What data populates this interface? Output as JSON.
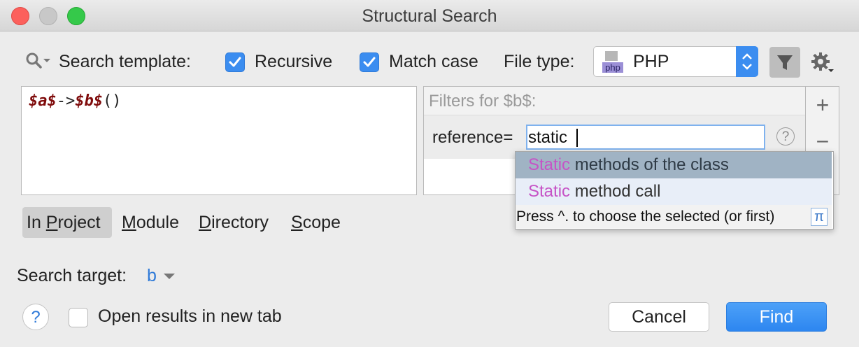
{
  "window": {
    "title": "Structural Search"
  },
  "toolbar": {
    "search_template_label": "Search template:",
    "recursive_label": "Recursive",
    "recursive_checked": true,
    "match_case_label": "Match case",
    "match_case_checked": true,
    "file_type_label": "File type:",
    "file_type_value": "PHP",
    "file_type_icon_text": "php"
  },
  "editor": {
    "code_parts": [
      "$a$",
      "->",
      "$b$",
      "()"
    ]
  },
  "filters": {
    "header": "Filters for $b$:",
    "row_label": "reference=",
    "input_value": "static",
    "add_label": "+",
    "remove_label": "−"
  },
  "completion": {
    "items": [
      {
        "highlight": "Static",
        "rest": " methods of the class"
      },
      {
        "highlight": "Static",
        "rest": " method call"
      }
    ],
    "hint": "Press ^. to choose the selected (or first)",
    "hint_icon": "π"
  },
  "scopes": [
    {
      "pre": "In ",
      "accel": "P",
      "post": "roject",
      "active": true
    },
    {
      "pre": "",
      "accel": "M",
      "post": "odule",
      "active": false
    },
    {
      "pre": "",
      "accel": "D",
      "post": "irectory",
      "active": false
    },
    {
      "pre": "",
      "accel": "S",
      "post": "cope",
      "active": false
    }
  ],
  "search_target": {
    "label": "Search target:",
    "value": "b"
  },
  "footer": {
    "help_label": "?",
    "open_new_tab_label": "Open results in new tab",
    "open_new_tab_checked": false,
    "cancel_label": "Cancel",
    "find_label": "Find"
  },
  "colors": {
    "accent": "#3b8df0",
    "variable": "#7f0b0b",
    "match_highlight": "#c653c6"
  }
}
